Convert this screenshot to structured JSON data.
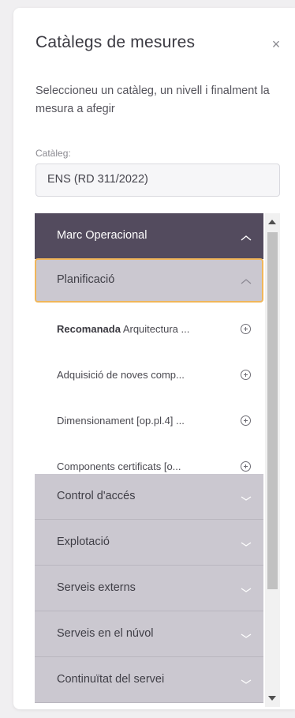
{
  "panel": {
    "title": "Catàlegs de mesures",
    "close_icon": "close-icon",
    "description": "Seleccioneu un catàleg, un nivell i finalment la mesura a afegir",
    "catalog_label": "Catàleg:",
    "catalog_value": "ENS (RD 311/2022)"
  },
  "tree": {
    "category": {
      "label": "Marc Operacional",
      "icon": "chevron-up-icon"
    },
    "subcategory": {
      "label": "Planificació",
      "icon": "chevron-up-icon"
    },
    "items": [
      {
        "prefix": "Recomanada",
        "text": " Arquitectura ...",
        "icon": "add-circle-icon"
      },
      {
        "prefix": "",
        "text": "Adquisició de noves comp...",
        "icon": "add-circle-icon"
      },
      {
        "prefix": "",
        "text": "Dimensionament [op.pl.4] ...",
        "icon": "add-circle-icon"
      },
      {
        "prefix": "",
        "text": "Components certificats [o...",
        "icon": "add-circle-icon"
      }
    ],
    "groups": [
      {
        "label": "Control d'accés",
        "icon": "chevron-down-icon"
      },
      {
        "label": "Explotació",
        "icon": "chevron-down-icon"
      },
      {
        "label": "Serveis externs",
        "icon": "chevron-down-icon"
      },
      {
        "label": "Serveis en el núvol",
        "icon": "chevron-down-icon"
      },
      {
        "label": "Continuïtat del servei",
        "icon": "chevron-down-icon"
      }
    ]
  },
  "colors": {
    "category_bg": "#534b5e",
    "group_bg": "#cbc8d0",
    "focus_border": "#f0b65a"
  }
}
